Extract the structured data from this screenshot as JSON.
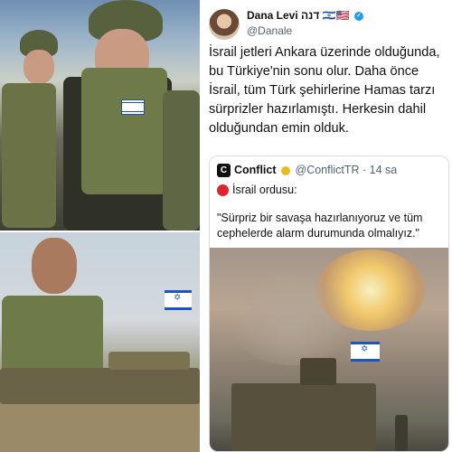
{
  "tweet": {
    "author_name": "Dana Levi",
    "author_name_suffix": "דנה 🇮🇱🇺🇸",
    "handle": "@Danale",
    "text": "İsrail jetleri Ankara üzerinde olduğunda, bu Türkiye'nin sonu olur. Daha önce İsrail, tüm Türk şehirlerine Hamas tarzı sürprizler hazırlamıştı. Herkesin dahil olduğundan emin olduk."
  },
  "quoted": {
    "logo_letter": "C",
    "name": "Conflict",
    "handle": "@ConflictTR",
    "time": "· 14 sa",
    "headline": "İsrail ordusu:",
    "quote": "\"Sürpriz bir savaşa hazırlanıyoruz ve tüm cephelerde alarm durumunda olmalıyız.\""
  },
  "colors": {
    "verified_blue": "#1d9bf0",
    "gold_badge": "#e8b923",
    "red_dot": "#e0242b",
    "text": "#111111",
    "secondary_text": "#536471"
  }
}
